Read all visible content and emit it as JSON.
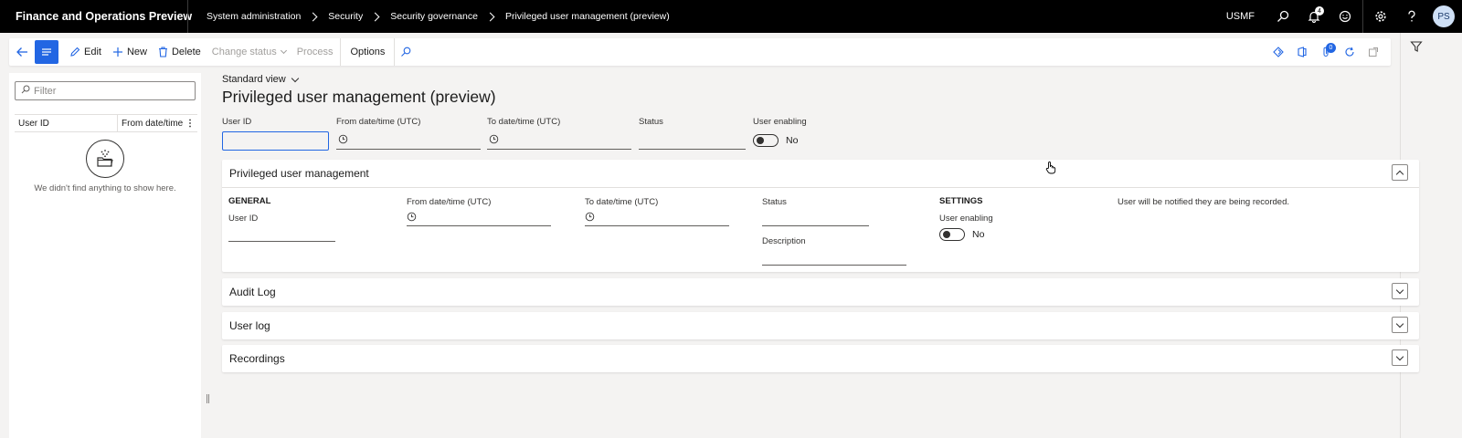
{
  "app": {
    "title": "Finance and Operations Preview"
  },
  "breadcrumb": [
    "System administration",
    "Security",
    "Security governance",
    "Privileged user management (preview)"
  ],
  "topbar": {
    "company": "USMF",
    "notification_count": "4",
    "avatar_initials": "PS"
  },
  "actions": {
    "edit": "Edit",
    "new": "New",
    "delete": "Delete",
    "change_status": "Change status",
    "process": "Process",
    "options": "Options",
    "attachments_count": "0"
  },
  "listpane": {
    "filter_placeholder": "Filter",
    "columns": [
      "User ID",
      "From date/time (U"
    ],
    "empty_message": "We didn't find anything to show here."
  },
  "page": {
    "view": "Standard view",
    "title": "Privileged user management (preview)"
  },
  "header_fields": {
    "user_id": {
      "label": "User ID",
      "value": ""
    },
    "from": {
      "label": "From date/time (UTC)",
      "value": ""
    },
    "to": {
      "label": "To date/time (UTC)",
      "value": ""
    },
    "status": {
      "label": "Status",
      "value": ""
    },
    "user_enabling": {
      "label": "User enabling",
      "value": "No"
    }
  },
  "fasttabs": {
    "main": {
      "title": "Privileged user management",
      "general_title": "GENERAL",
      "user_id_label": "User ID",
      "from_label": "From date/time (UTC)",
      "to_label": "To date/time (UTC)",
      "status_label": "Status",
      "description_label": "Description",
      "settings_title": "SETTINGS",
      "user_enabling_label": "User enabling",
      "user_enabling_value": "No",
      "note": "User will be notified they are being recorded."
    },
    "audit_log": "Audit Log",
    "user_log": "User log",
    "recordings": "Recordings"
  },
  "colors": {
    "accent": "#2266e3",
    "topbar": "#000000"
  }
}
